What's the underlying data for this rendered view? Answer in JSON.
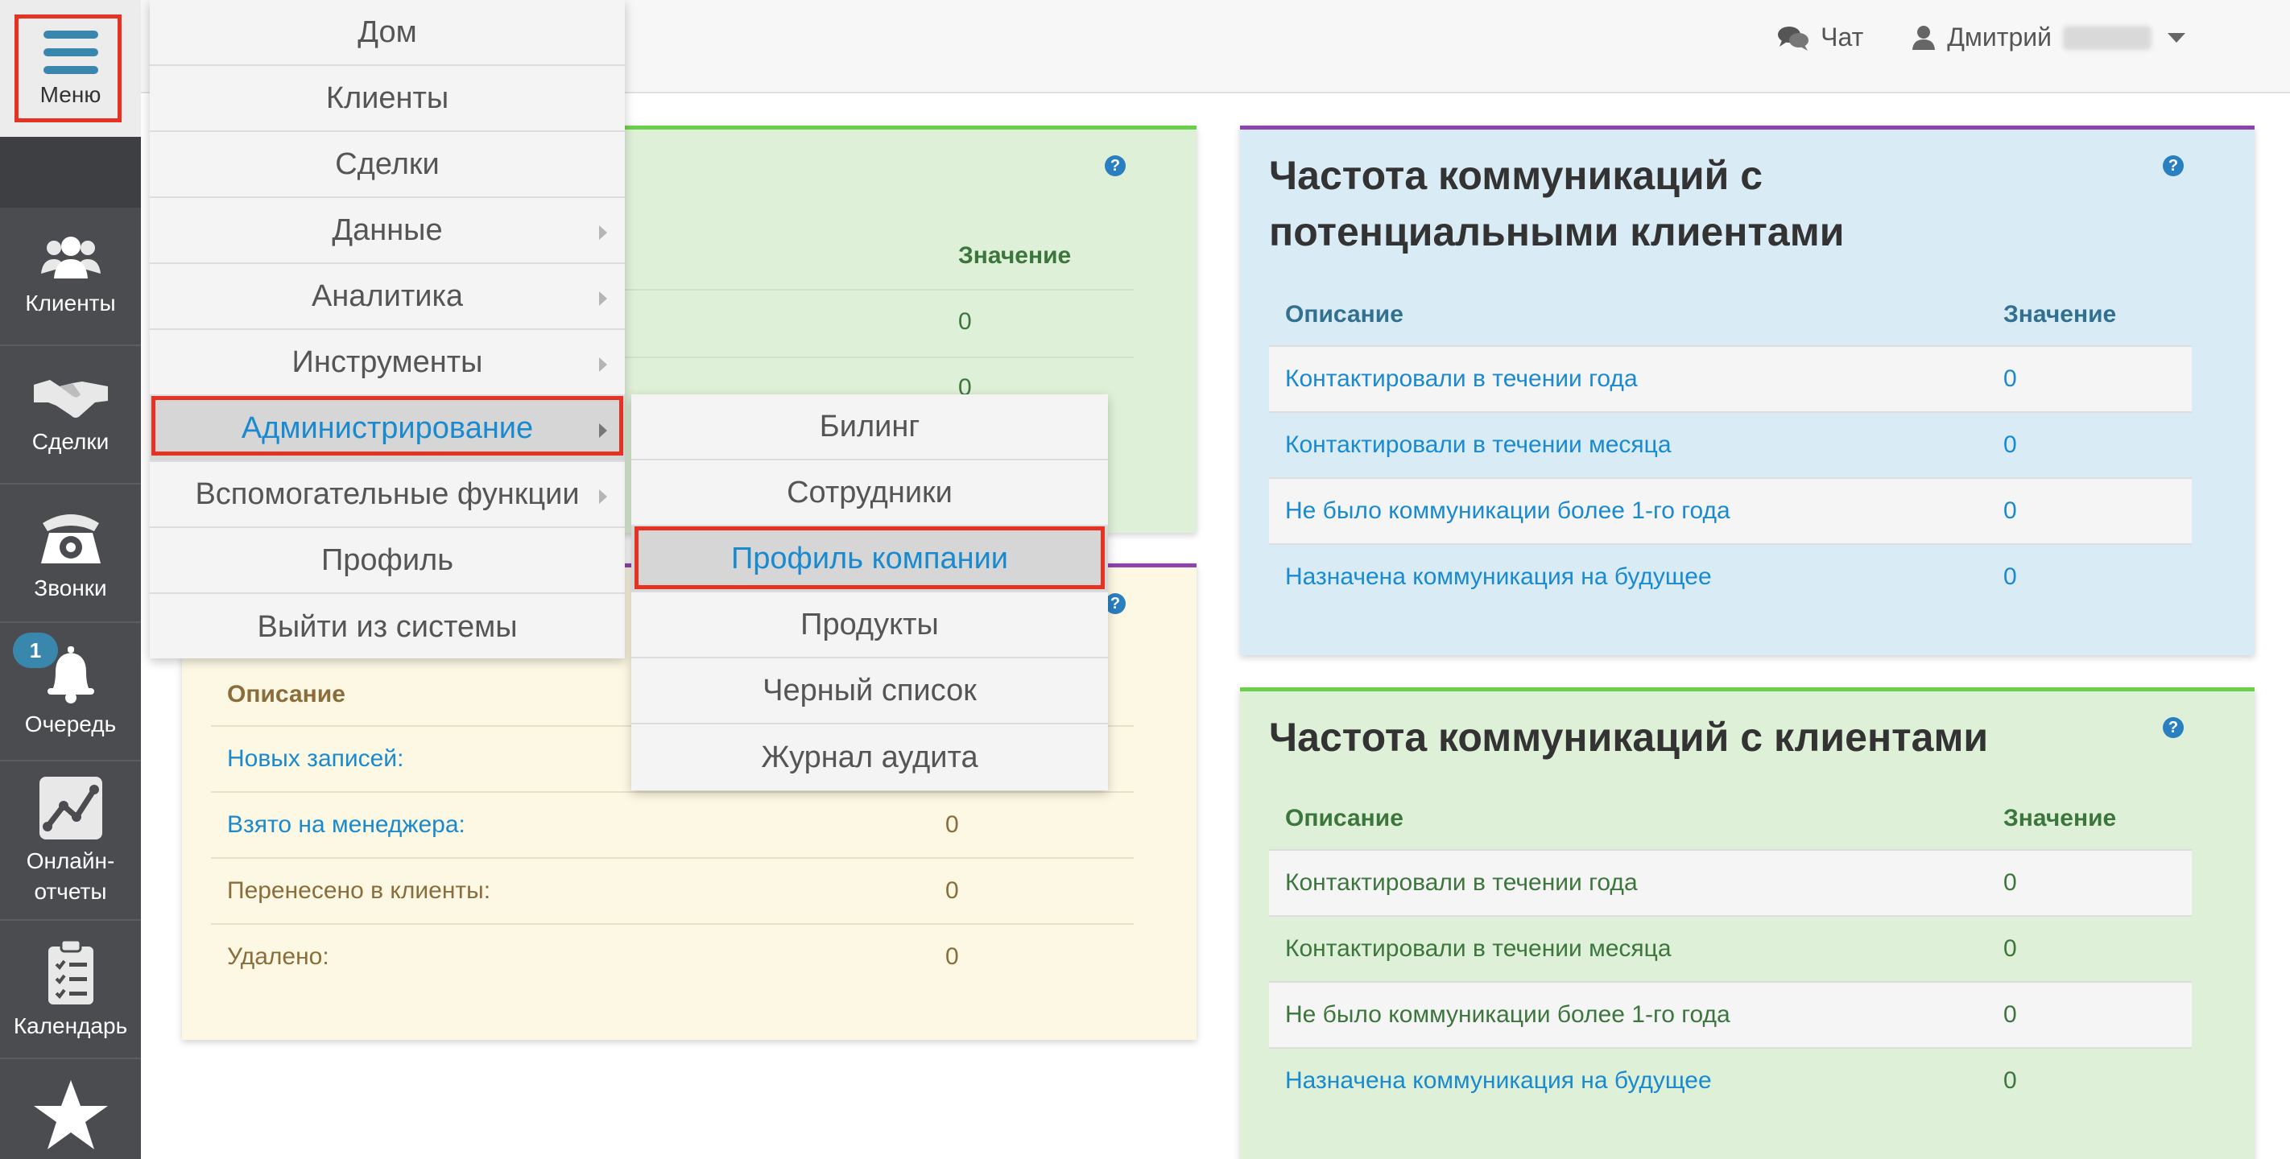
{
  "header": {
    "chat_label": "Чат",
    "user_name": "Дмитрий"
  },
  "sidebar": {
    "menu_label": "Меню",
    "items": [
      {
        "label": "Клиенты",
        "icon": "users-icon"
      },
      {
        "label": "Сделки",
        "icon": "handshake-icon"
      },
      {
        "label": "Звонки",
        "icon": "phone-icon"
      },
      {
        "label": "Очередь",
        "icon": "bell-icon",
        "badge": "1"
      },
      {
        "label": "Онлайн-\nотчеты",
        "icon": "chart-icon"
      },
      {
        "label": "Календарь",
        "icon": "clipboard-icon"
      },
      {
        "label": "",
        "icon": "star-icon"
      }
    ]
  },
  "main_menu": {
    "items": [
      {
        "label": "Дом",
        "submenu": false
      },
      {
        "label": "Клиенты",
        "submenu": false
      },
      {
        "label": "Сделки",
        "submenu": false
      },
      {
        "label": "Данные",
        "submenu": true
      },
      {
        "label": "Аналитика",
        "submenu": true
      },
      {
        "label": "Инструменты",
        "submenu": true
      },
      {
        "label": "Администрирование",
        "submenu": true,
        "active": true
      },
      {
        "label": "Вспомогательные функции",
        "submenu": true
      },
      {
        "label": "Профиль",
        "submenu": false
      },
      {
        "label": "Выйти из системы",
        "submenu": false
      }
    ]
  },
  "admin_submenu": {
    "items": [
      {
        "label": "Билинг"
      },
      {
        "label": "Сотрудники"
      },
      {
        "label": "Профиль компании",
        "active": true
      },
      {
        "label": "Продукты"
      },
      {
        "label": "Черный список"
      },
      {
        "label": "Журнал аудита"
      }
    ]
  },
  "panel_green_left": {
    "value_header": "Значение",
    "values": [
      "0",
      "0"
    ]
  },
  "panel_yellow": {
    "desc_header": "Описание",
    "rows": [
      {
        "desc": "Новых записей:",
        "value": ""
      },
      {
        "desc": "Взято на менеджера:",
        "value": "0"
      },
      {
        "desc": "Перенесено в клиенты:",
        "value": "0"
      },
      {
        "desc": "Удалено:",
        "value": "0"
      }
    ]
  },
  "panel_leads": {
    "title_line1": "Частота коммуникаций с",
    "title_line2": "потенциальными клиентами",
    "desc_header": "Описание",
    "value_header": "Значение",
    "rows": [
      {
        "desc": "Контактировали в течении года",
        "value": "0"
      },
      {
        "desc": "Контактировали в течении месяца",
        "value": "0"
      },
      {
        "desc": "Не было коммуникации более 1-го года",
        "value": "0"
      },
      {
        "desc": "Назначена коммуникация на будущее",
        "value": "0"
      }
    ]
  },
  "panel_clients": {
    "title": "Частота коммуникаций с клиентами",
    "desc_header": "Описание",
    "value_header": "Значение",
    "rows": [
      {
        "desc": "Контактировали в течении года",
        "value": "0"
      },
      {
        "desc": "Контактировали в течении месяца",
        "value": "0"
      },
      {
        "desc": "Не было коммуникации более 1-го года",
        "value": "0"
      },
      {
        "desc": "Назначена коммуникация на будущее",
        "value": "0"
      }
    ]
  },
  "help_symbol": "?",
  "colors": {
    "accent_blue": "#1a8ad0",
    "highlight_red": "#e53222",
    "green_text": "#3c763d",
    "brown_text": "#8a6d3b",
    "sidebar_bg": "#4b4c50"
  }
}
